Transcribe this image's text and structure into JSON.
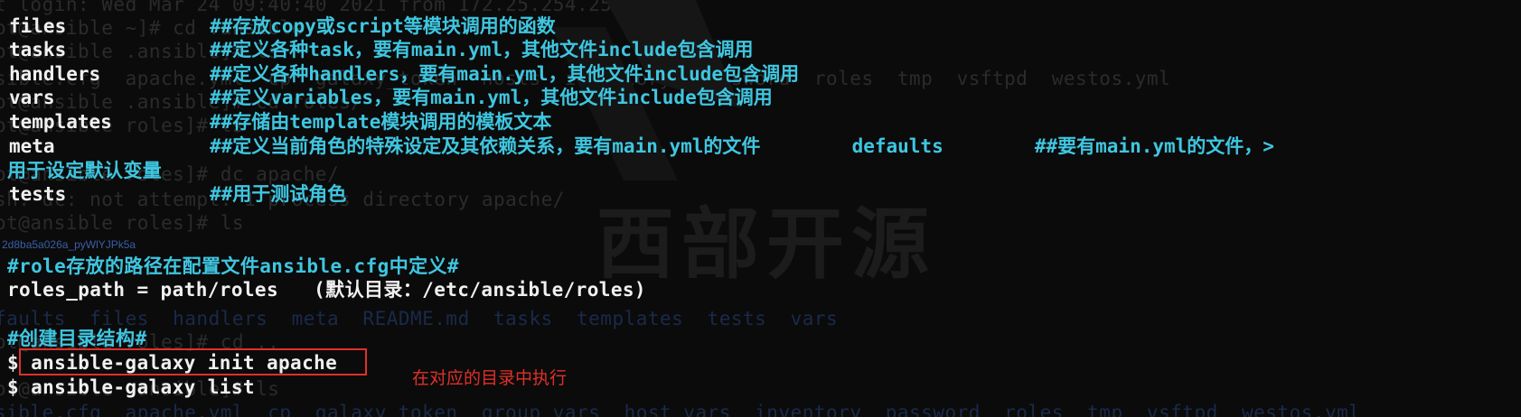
{
  "ghost_lines": [
    "t login: Wed Mar 24 09:40:40 2021 from 172.25.254.250",
    "ot@ansible ~]# cd .ansible",
    "ot@ansible .ansible]# ls",
    "sible.cfg  apache.yml  cp  galaxy_token  hosts  inventory  password  roles  tmp  vsftpd  westos.yml",
    "ot@ansible .ansible]# cd roles/",
    "ot@ansible roles]# ls",
    "ot@ansible roles]# dc apache/",
    "sh: dc: not attempt: 1 process directory apache/",
    "ot@ansible roles]# ls",
    "faults  files  handlers  meta  README.md  tasks  templates  tests  vars",
    "ot@ansible roles]# cd ..",
    "ot@ansible .ansible]# ls",
    "sible.cfg  apache.yml  cp  galaxy_token  group_vars  host_vars  inventory  password  roles  tmp  vsftpd  westos.yml"
  ],
  "watermark": "西部开源",
  "rows": [
    {
      "key": "files",
      "desc": "##存放copy或script等模块调用的函数"
    },
    {
      "key": "tasks",
      "desc": "##定义各种task，要有main.yml，其他文件include包含调用"
    },
    {
      "key": "handlers",
      "desc": "##定义各种handlers，要有main.yml，其他文件include包含调用"
    },
    {
      "key": "vars",
      "desc": "##定义variables，要有main.yml，其他文件include包含调用"
    },
    {
      "key": "templates",
      "desc": "##存储由template模块调用的模板文本"
    },
    {
      "key": "meta",
      "desc": "##定义当前角色的特殊设定及其依赖关系，要有main.yml的文件        defaults        ##要有main.yml的文件，>"
    }
  ],
  "wrapped_line": "用于设定默认变量",
  "tests_row": {
    "key": "tests",
    "desc": "##用于测试角色"
  },
  "image_id": "2d8ba5a026a_pyWlYJPk5a",
  "role_path_comment": "#role存放的路径在配置文件ansible.cfg中定义#",
  "role_path_value": "roles_path = path/roles   (默认目录：/etc/ansible/roles)",
  "create_comment": "#创建目录结构#",
  "commands": [
    "$ ansible-galaxy init apache",
    "$ ansible-galaxy list"
  ],
  "annotation": "在对应的目录中执行",
  "colors": {
    "background": "#0b0b0b",
    "text": "#f0f0f0",
    "cyan": "#3fc6e0",
    "highlight": "#e0302a",
    "id_text": "#3a5ea8"
  }
}
